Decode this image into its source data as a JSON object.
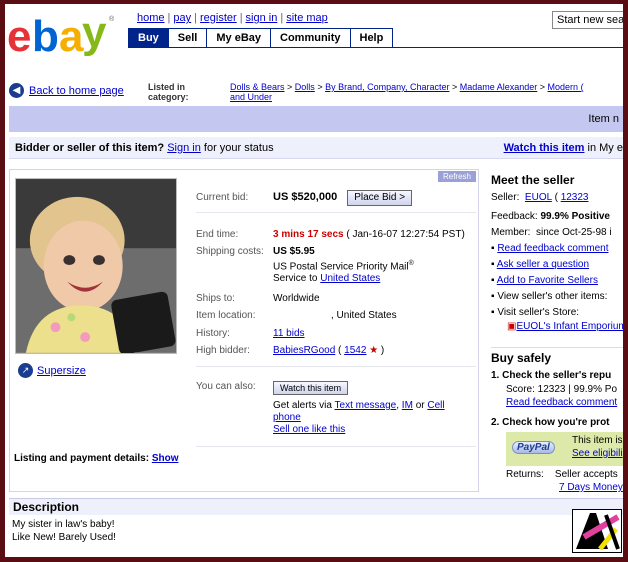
{
  "header": {
    "logo_letters": [
      "e",
      "b",
      "a",
      "y"
    ],
    "top_links": [
      "home",
      "pay",
      "register",
      "sign in",
      "site map"
    ],
    "search_placeholder": "Start new search",
    "tabs": [
      "Buy",
      "Sell",
      "My eBay",
      "Community",
      "Help"
    ]
  },
  "nav": {
    "back": "Back to home page",
    "listed_label_1": "Listed in",
    "listed_label_2": "category:",
    "crumbs": [
      "Dolls & Bears",
      "Dolls",
      "By Brand, Company, Character",
      "Madame Alexander",
      "Modern (",
      "and Under"
    ]
  },
  "item_bar": "Item n",
  "bidder_bar": {
    "prefix": "Bidder or seller of this item?",
    "sign_in": "Sign in",
    "suffix": "for your status",
    "watch": "Watch this item",
    "watch_suffix": "in My e"
  },
  "item": {
    "refresh": "Refresh",
    "supersize": "Supersize",
    "current_bid_label": "Current bid:",
    "current_bid": "US $520,000",
    "place_bid": "Place Bid >",
    "end_time_label": "End time:",
    "end_time_left": "3 mins 17 secs",
    "end_time_date": "( Jan-16-07 12:27:54 PST)",
    "shipping_label": "Shipping costs:",
    "shipping": "US $5.95",
    "shipping_service_1": "US Postal Service Priority Mail",
    "shipping_service_2": "Service to",
    "shipping_country": "United States",
    "ships_to_label": "Ships to:",
    "ships_to": "Worldwide",
    "location_label": "Item location:",
    "location": ", United States",
    "history_label": "History:",
    "history": "11 bids",
    "high_bidder_label": "High bidder:",
    "high_bidder": "BabiesRGood",
    "high_bidder_score": "1542",
    "you_can_label": "You can also:",
    "watch_button": "Watch this item",
    "alerts_prefix": "Get alerts via",
    "alerts_text": "Text message",
    "alerts_im": "IM",
    "alerts_or": "or",
    "alerts_cell": "Cell phone",
    "sell_one": "Sell one like this",
    "listing_label": "Listing and payment details:",
    "listing_show": "Show"
  },
  "seller": {
    "title": "Meet the seller",
    "seller_label": "Seller:",
    "seller_name": "EUOL",
    "seller_score": "12323",
    "feedback_label": "Feedback:",
    "feedback": "99.9% Positive",
    "member_label": "Member:",
    "member": "since Oct-25-98 i",
    "links": [
      "Read feedback comment",
      "Ask seller a question",
      "Add to Favorite Sellers"
    ],
    "view_other": "View seller's other items:",
    "visit_store": "Visit seller's Store:",
    "store": "EUOL's Infant Emporium"
  },
  "buy_safely": {
    "title": "Buy safely",
    "step1": "1.  Check the seller's repu",
    "score": "Score: 12323 | 99.9% Po",
    "read_feedback": "Read feedback comment",
    "step2": "2.  Check how you're prot",
    "paypal": "PayPal",
    "paypal_text": "This item is",
    "paypal_link": "See eligibili",
    "returns_label": "Returns:",
    "returns": "Seller accepts",
    "returns_link": "7 Days Money"
  },
  "description": {
    "title": "Description",
    "line1": "My sister in law's baby!",
    "line2": "Like New!  Barely Used!"
  },
  "colors": {
    "ebay_e": "#e53238",
    "ebay_b": "#0064d2",
    "ebay_a": "#f5af02",
    "ebay_y": "#86b817",
    "tab_blue": "#00248a",
    "link": "#0000cc",
    "frame": "#5a0d12"
  }
}
